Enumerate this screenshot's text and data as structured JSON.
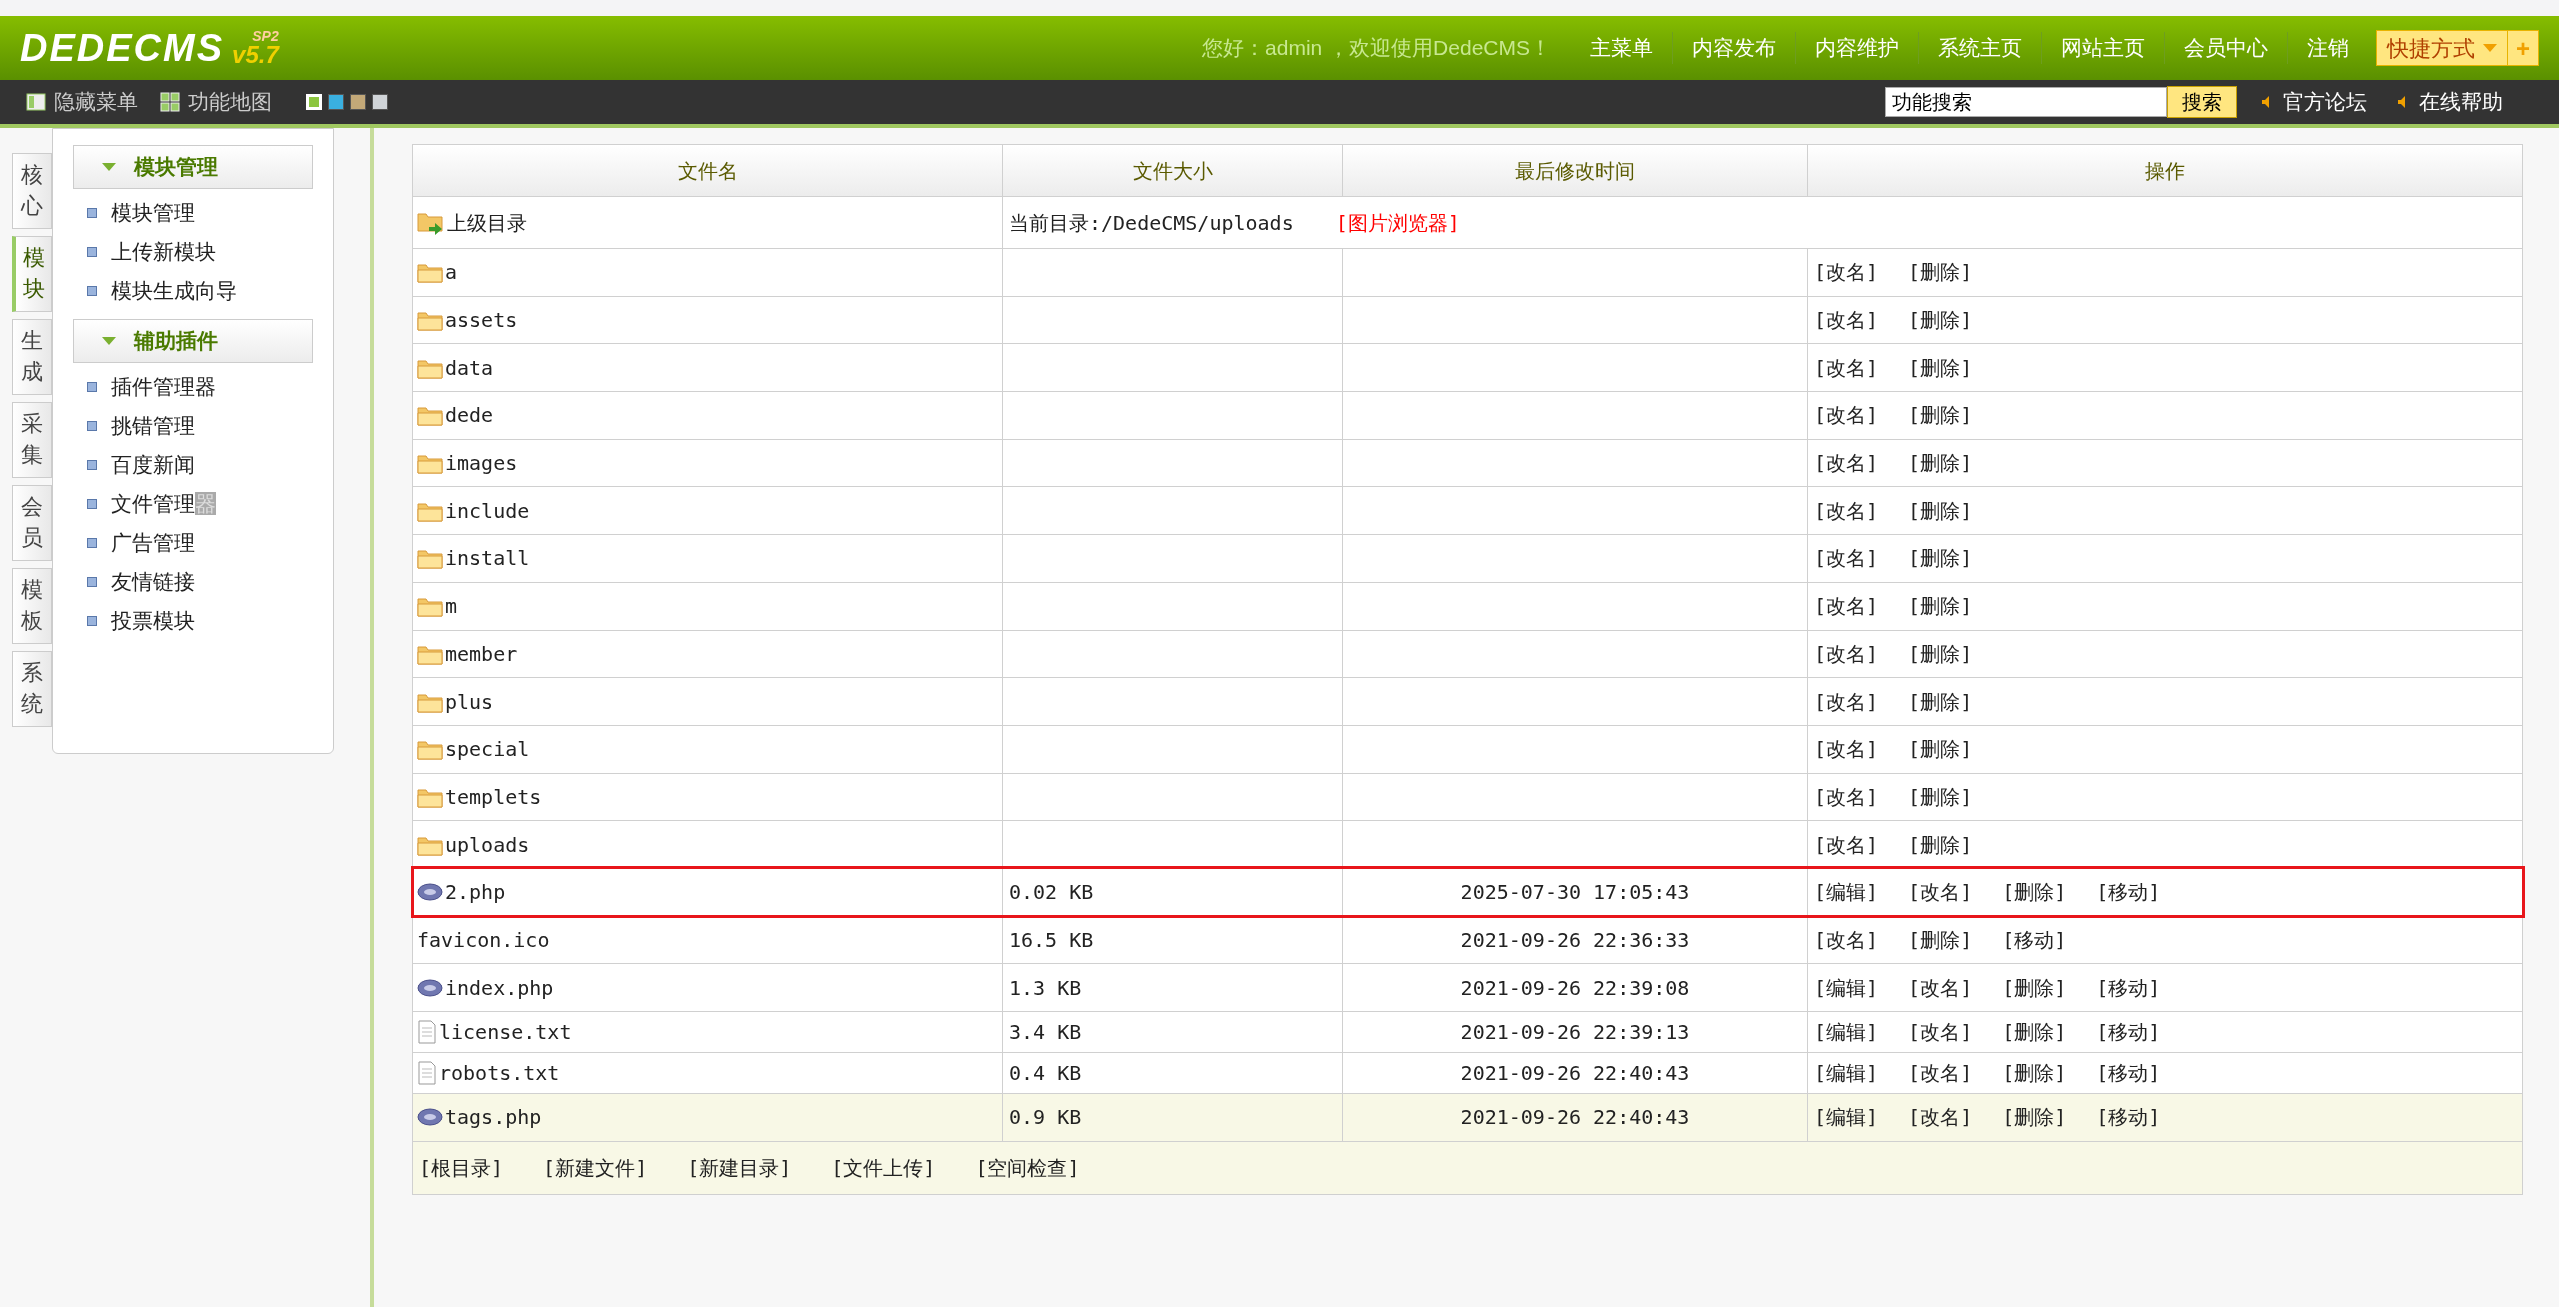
{
  "header": {
    "logo": "DEDECMS",
    "version": "v5.7",
    "edition": "SP2",
    "greeting": "您好：admin ，欢迎使用DedeCMS！",
    "nav": [
      "主菜单",
      "内容发布",
      "内容维护",
      "系统主页",
      "网站主页",
      "会员中心",
      "注销"
    ],
    "shortcut": "快捷方式",
    "shortcut_add": "+"
  },
  "toolbar": {
    "hide_menu": "隐藏菜单",
    "function_map": "功能地图",
    "themes": [
      {
        "color": "#8cc63f",
        "selected": true
      },
      {
        "color": "#3ab0e0",
        "selected": false
      },
      {
        "color": "#c2a878",
        "selected": false
      },
      {
        "color": "#d0d4d8",
        "selected": false
      }
    ],
    "search": {
      "value": "功能搜索"
    },
    "search_button": "搜索",
    "links": [
      "官方论坛",
      "在线帮助"
    ]
  },
  "side_tabs": [
    {
      "label": "核心",
      "selected": false
    },
    {
      "label": "模块",
      "selected": true
    },
    {
      "label": "生成",
      "selected": false
    },
    {
      "label": "采集",
      "selected": false
    },
    {
      "label": "会员",
      "selected": false
    },
    {
      "label": "模板",
      "selected": false
    },
    {
      "label": "系统",
      "selected": false
    }
  ],
  "sidebar": {
    "groups": [
      {
        "title": "模块管理",
        "expanded": true,
        "items": [
          {
            "label": "模块管理"
          },
          {
            "label": "上传新模块"
          },
          {
            "label": "模块生成向导"
          }
        ]
      },
      {
        "title": "辅助插件",
        "expanded": true,
        "items": [
          {
            "label": "插件管理器"
          },
          {
            "label": "挑错管理"
          },
          {
            "label": "百度新闻"
          },
          {
            "label": "文件管理",
            "tail": "器"
          },
          {
            "label": "广告管理"
          },
          {
            "label": "友情链接"
          },
          {
            "label": "投票模块"
          }
        ]
      }
    ]
  },
  "table": {
    "columns": [
      "文件名",
      "文件大小",
      "最后修改时间",
      "操作"
    ],
    "parent": {
      "label": "上级目录",
      "current_dir": "当前目录:/DedeCMS/uploads",
      "image_browser": "[图片浏览器]"
    },
    "rows": [
      {
        "kind": "folder",
        "name": "a",
        "size": "",
        "modified": "",
        "actions": [
          "[改名]",
          "[删除]"
        ],
        "annotated": false,
        "hovered": false
      },
      {
        "kind": "folder",
        "name": "assets",
        "size": "",
        "modified": "",
        "actions": [
          "[改名]",
          "[删除]"
        ],
        "annotated": false,
        "hovered": false
      },
      {
        "kind": "folder",
        "name": "data",
        "size": "",
        "modified": "",
        "actions": [
          "[改名]",
          "[删除]"
        ],
        "annotated": false,
        "hovered": false
      },
      {
        "kind": "folder",
        "name": "dede",
        "size": "",
        "modified": "",
        "actions": [
          "[改名]",
          "[删除]"
        ],
        "annotated": false,
        "hovered": false
      },
      {
        "kind": "folder",
        "name": "images",
        "size": "",
        "modified": "",
        "actions": [
          "[改名]",
          "[删除]"
        ],
        "annotated": false,
        "hovered": false
      },
      {
        "kind": "folder",
        "name": "include",
        "size": "",
        "modified": "",
        "actions": [
          "[改名]",
          "[删除]"
        ],
        "annotated": false,
        "hovered": false
      },
      {
        "kind": "folder",
        "name": "install",
        "size": "",
        "modified": "",
        "actions": [
          "[改名]",
          "[删除]"
        ],
        "annotated": false,
        "hovered": false
      },
      {
        "kind": "folder",
        "name": "m",
        "size": "",
        "modified": "",
        "actions": [
          "[改名]",
          "[删除]"
        ],
        "annotated": false,
        "hovered": false
      },
      {
        "kind": "folder",
        "name": "member",
        "size": "",
        "modified": "",
        "actions": [
          "[改名]",
          "[删除]"
        ],
        "annotated": false,
        "hovered": false
      },
      {
        "kind": "folder",
        "name": "plus",
        "size": "",
        "modified": "",
        "actions": [
          "[改名]",
          "[删除]"
        ],
        "annotated": false,
        "hovered": false
      },
      {
        "kind": "folder",
        "name": "special",
        "size": "",
        "modified": "",
        "actions": [
          "[改名]",
          "[删除]"
        ],
        "annotated": false,
        "hovered": false
      },
      {
        "kind": "folder",
        "name": "templets",
        "size": "",
        "modified": "",
        "actions": [
          "[改名]",
          "[删除]"
        ],
        "annotated": false,
        "hovered": false
      },
      {
        "kind": "folder",
        "name": "uploads",
        "size": "",
        "modified": "",
        "actions": [
          "[改名]",
          "[删除]"
        ],
        "annotated": false,
        "hovered": false
      },
      {
        "kind": "php",
        "name": "2.php",
        "size": "0.02 KB",
        "modified": "2025-07-30 17:05:43",
        "actions": [
          "[编辑]",
          "[改名]",
          "[删除]",
          "[移动]"
        ],
        "annotated": true,
        "hovered": false
      },
      {
        "kind": "plain",
        "name": "favicon.ico",
        "size": "16.5 KB",
        "modified": "2021-09-26 22:36:33",
        "actions": [
          "[改名]",
          "[删除]",
          "[移动]"
        ],
        "annotated": false,
        "hovered": false
      },
      {
        "kind": "php",
        "name": "index.php",
        "size": "1.3 KB",
        "modified": "2021-09-26 22:39:08",
        "actions": [
          "[编辑]",
          "[改名]",
          "[删除]",
          "[移动]"
        ],
        "annotated": false,
        "hovered": false
      },
      {
        "kind": "text",
        "name": "license.txt",
        "size": "3.4 KB",
        "modified": "2021-09-26 22:39:13",
        "actions": [
          "[编辑]",
          "[改名]",
          "[删除]",
          "[移动]"
        ],
        "annotated": false,
        "hovered": false
      },
      {
        "kind": "text",
        "name": "robots.txt",
        "size": "0.4 KB",
        "modified": "2021-09-26 22:40:43",
        "actions": [
          "[编辑]",
          "[改名]",
          "[删除]",
          "[移动]"
        ],
        "annotated": false,
        "hovered": false
      },
      {
        "kind": "php",
        "name": "tags.php",
        "size": "0.9 KB",
        "modified": "2021-09-26 22:40:43",
        "actions": [
          "[编辑]",
          "[改名]",
          "[删除]",
          "[移动]"
        ],
        "annotated": false,
        "hovered": true
      }
    ],
    "footer_links": [
      "[根目录]",
      "[新建文件]",
      "[新建目录]",
      "[文件上传]",
      "[空间检查]"
    ]
  }
}
